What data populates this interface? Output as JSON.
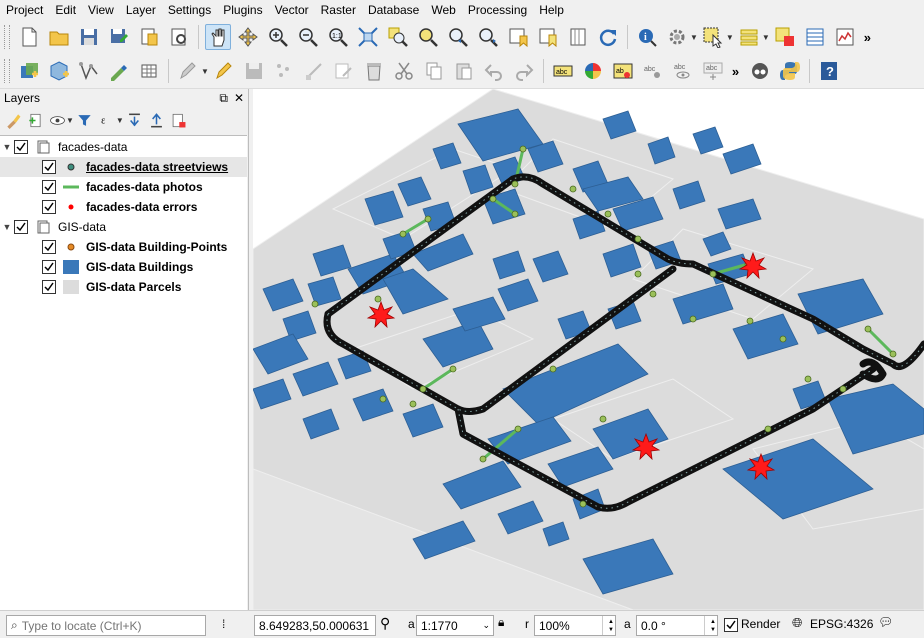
{
  "menu": [
    "Project",
    "Edit",
    "View",
    "Layer",
    "Settings",
    "Plugins",
    "Vector",
    "Raster",
    "Database",
    "Web",
    "Processing",
    "Help"
  ],
  "layers_panel": {
    "title": "Layers",
    "groups": [
      {
        "name": "facades-data",
        "layers": [
          {
            "name": "facades-data streetviews",
            "symbol": "point-teal"
          },
          {
            "name": "facades-data photos",
            "symbol": "line-green"
          },
          {
            "name": "facades-data errors",
            "symbol": "point-red"
          }
        ]
      },
      {
        "name": "GIS-data",
        "layers": [
          {
            "name": "GIS-data Building-Points",
            "symbol": "point-orange"
          },
          {
            "name": "GIS-data Buildings",
            "symbol": "fill-blue"
          },
          {
            "name": "GIS-data Parcels",
            "symbol": "fill-gray"
          }
        ]
      }
    ]
  },
  "colors": {
    "building": "#3a78b9",
    "parcel": "#dcdcdc",
    "photo_line": "#5cb85c",
    "streetview": "#3e8e7e",
    "error": "#ff0000",
    "point": "#e58a26"
  },
  "status": {
    "locate_placeholder": "Type to locate (Ctrl+K)",
    "coordinate": "8.649283,50.000631",
    "scale_label": "a",
    "scale": "1:1770",
    "magnifier_label": "r",
    "magnifier": "100%",
    "rotation_label": "a",
    "rotation": "0.0 °",
    "render_label": "Render",
    "crs": "EPSG:4326"
  }
}
